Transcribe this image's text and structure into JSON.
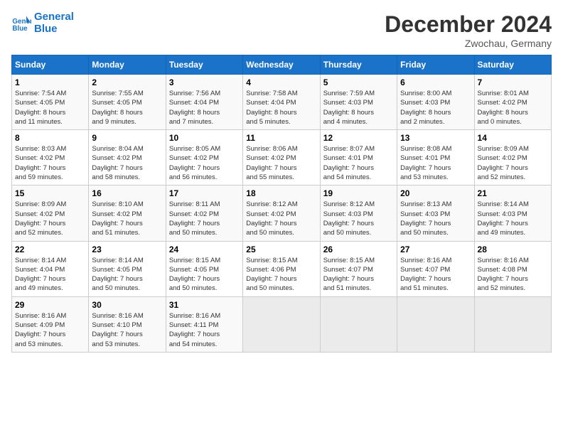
{
  "logo": {
    "line1": "General",
    "line2": "Blue"
  },
  "title": "December 2024",
  "subtitle": "Zwochau, Germany",
  "days_of_week": [
    "Sunday",
    "Monday",
    "Tuesday",
    "Wednesday",
    "Thursday",
    "Friday",
    "Saturday"
  ],
  "weeks": [
    [
      {
        "day": "1",
        "info": "Sunrise: 7:54 AM\nSunset: 4:05 PM\nDaylight: 8 hours\nand 11 minutes."
      },
      {
        "day": "2",
        "info": "Sunrise: 7:55 AM\nSunset: 4:05 PM\nDaylight: 8 hours\nand 9 minutes."
      },
      {
        "day": "3",
        "info": "Sunrise: 7:56 AM\nSunset: 4:04 PM\nDaylight: 8 hours\nand 7 minutes."
      },
      {
        "day": "4",
        "info": "Sunrise: 7:58 AM\nSunset: 4:04 PM\nDaylight: 8 hours\nand 5 minutes."
      },
      {
        "day": "5",
        "info": "Sunrise: 7:59 AM\nSunset: 4:03 PM\nDaylight: 8 hours\nand 4 minutes."
      },
      {
        "day": "6",
        "info": "Sunrise: 8:00 AM\nSunset: 4:03 PM\nDaylight: 8 hours\nand 2 minutes."
      },
      {
        "day": "7",
        "info": "Sunrise: 8:01 AM\nSunset: 4:02 PM\nDaylight: 8 hours\nand 0 minutes."
      }
    ],
    [
      {
        "day": "8",
        "info": "Sunrise: 8:03 AM\nSunset: 4:02 PM\nDaylight: 7 hours\nand 59 minutes."
      },
      {
        "day": "9",
        "info": "Sunrise: 8:04 AM\nSunset: 4:02 PM\nDaylight: 7 hours\nand 58 minutes."
      },
      {
        "day": "10",
        "info": "Sunrise: 8:05 AM\nSunset: 4:02 PM\nDaylight: 7 hours\nand 56 minutes."
      },
      {
        "day": "11",
        "info": "Sunrise: 8:06 AM\nSunset: 4:02 PM\nDaylight: 7 hours\nand 55 minutes."
      },
      {
        "day": "12",
        "info": "Sunrise: 8:07 AM\nSunset: 4:01 PM\nDaylight: 7 hours\nand 54 minutes."
      },
      {
        "day": "13",
        "info": "Sunrise: 8:08 AM\nSunset: 4:01 PM\nDaylight: 7 hours\nand 53 minutes."
      },
      {
        "day": "14",
        "info": "Sunrise: 8:09 AM\nSunset: 4:02 PM\nDaylight: 7 hours\nand 52 minutes."
      }
    ],
    [
      {
        "day": "15",
        "info": "Sunrise: 8:09 AM\nSunset: 4:02 PM\nDaylight: 7 hours\nand 52 minutes."
      },
      {
        "day": "16",
        "info": "Sunrise: 8:10 AM\nSunset: 4:02 PM\nDaylight: 7 hours\nand 51 minutes."
      },
      {
        "day": "17",
        "info": "Sunrise: 8:11 AM\nSunset: 4:02 PM\nDaylight: 7 hours\nand 50 minutes."
      },
      {
        "day": "18",
        "info": "Sunrise: 8:12 AM\nSunset: 4:02 PM\nDaylight: 7 hours\nand 50 minutes."
      },
      {
        "day": "19",
        "info": "Sunrise: 8:12 AM\nSunset: 4:03 PM\nDaylight: 7 hours\nand 50 minutes."
      },
      {
        "day": "20",
        "info": "Sunrise: 8:13 AM\nSunset: 4:03 PM\nDaylight: 7 hours\nand 50 minutes."
      },
      {
        "day": "21",
        "info": "Sunrise: 8:14 AM\nSunset: 4:03 PM\nDaylight: 7 hours\nand 49 minutes."
      }
    ],
    [
      {
        "day": "22",
        "info": "Sunrise: 8:14 AM\nSunset: 4:04 PM\nDaylight: 7 hours\nand 49 minutes."
      },
      {
        "day": "23",
        "info": "Sunrise: 8:14 AM\nSunset: 4:05 PM\nDaylight: 7 hours\nand 50 minutes."
      },
      {
        "day": "24",
        "info": "Sunrise: 8:15 AM\nSunset: 4:05 PM\nDaylight: 7 hours\nand 50 minutes."
      },
      {
        "day": "25",
        "info": "Sunrise: 8:15 AM\nSunset: 4:06 PM\nDaylight: 7 hours\nand 50 minutes."
      },
      {
        "day": "26",
        "info": "Sunrise: 8:15 AM\nSunset: 4:07 PM\nDaylight: 7 hours\nand 51 minutes."
      },
      {
        "day": "27",
        "info": "Sunrise: 8:16 AM\nSunset: 4:07 PM\nDaylight: 7 hours\nand 51 minutes."
      },
      {
        "day": "28",
        "info": "Sunrise: 8:16 AM\nSunset: 4:08 PM\nDaylight: 7 hours\nand 52 minutes."
      }
    ],
    [
      {
        "day": "29",
        "info": "Sunrise: 8:16 AM\nSunset: 4:09 PM\nDaylight: 7 hours\nand 53 minutes."
      },
      {
        "day": "30",
        "info": "Sunrise: 8:16 AM\nSunset: 4:10 PM\nDaylight: 7 hours\nand 53 minutes."
      },
      {
        "day": "31",
        "info": "Sunrise: 8:16 AM\nSunset: 4:11 PM\nDaylight: 7 hours\nand 54 minutes."
      },
      {
        "day": "",
        "info": ""
      },
      {
        "day": "",
        "info": ""
      },
      {
        "day": "",
        "info": ""
      },
      {
        "day": "",
        "info": ""
      }
    ]
  ]
}
